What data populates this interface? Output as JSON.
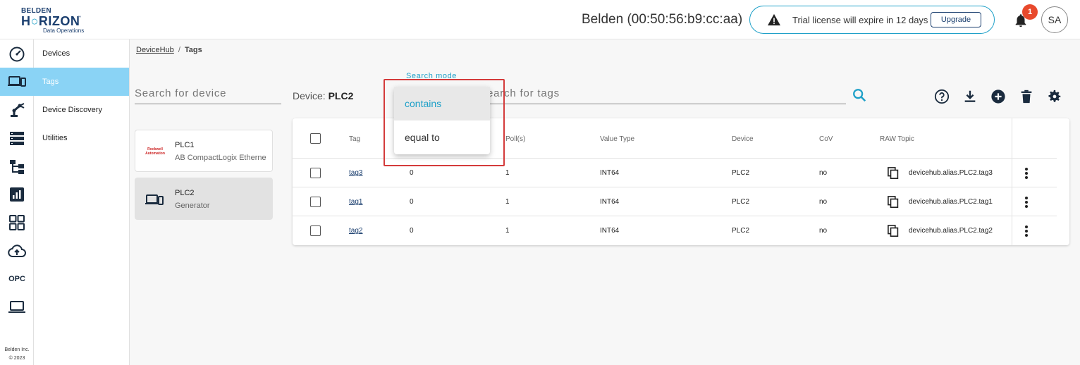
{
  "header": {
    "logo": {
      "line1": "BELDEN",
      "line2a": "H",
      "line2b": "RIZON",
      "line3": "Data Operations",
      "tm": "™"
    },
    "device_title": "Belden (00:50:56:b9:cc:aa)",
    "trial_text": "Trial license will expire in 12 days",
    "upgrade_label": "Upgrade",
    "notification_count": "1",
    "avatar_initials": "SA"
  },
  "rail": {
    "opc_label": "OPC",
    "footer_company": "Belden Inc.",
    "footer_year": "© 2023"
  },
  "nav": {
    "items": [
      {
        "label": "Devices"
      },
      {
        "label": "Tags"
      },
      {
        "label": "Device Discovery"
      },
      {
        "label": "Utilities"
      }
    ]
  },
  "breadcrumb": {
    "root": "DeviceHub",
    "sep": "/",
    "current": "Tags"
  },
  "device_panel": {
    "search_placeholder": "Search for device",
    "devices": [
      {
        "name": "PLC1",
        "desc": "AB CompactLogix Ethernet",
        "logo_text": "Rockwell Automation"
      },
      {
        "name": "PLC2",
        "desc": "Generator"
      }
    ]
  },
  "tags_panel": {
    "device_label": "Device:",
    "device_name": "PLC2",
    "search_mode_label": "Search mode",
    "search_placeholder": "earch for tags",
    "search_mode_options": [
      "contains",
      "equal to"
    ],
    "columns": [
      "Tag",
      "Poll(s)",
      "Value Type",
      "Device",
      "CoV",
      "RAW Topic"
    ],
    "rows": [
      {
        "tag": "tag3",
        "value": "0",
        "poll": "1",
        "type": "INT64",
        "device": "PLC2",
        "cov": "no",
        "topic": "devicehub.alias.PLC2.tag3"
      },
      {
        "tag": "tag1",
        "value": "0",
        "poll": "1",
        "type": "INT64",
        "device": "PLC2",
        "cov": "no",
        "topic": "devicehub.alias.PLC2.tag1"
      },
      {
        "tag": "tag2",
        "value": "0",
        "poll": "1",
        "type": "INT64",
        "device": "PLC2",
        "cov": "no",
        "topic": "devicehub.alias.PLC2.tag2"
      }
    ]
  },
  "colors": {
    "accent": "#1ea0c8",
    "active_nav": "#8ad3f5",
    "badge": "#e8492c",
    "highlight_border": "#d43b3b",
    "brand_dark": "#1a3e6e"
  }
}
